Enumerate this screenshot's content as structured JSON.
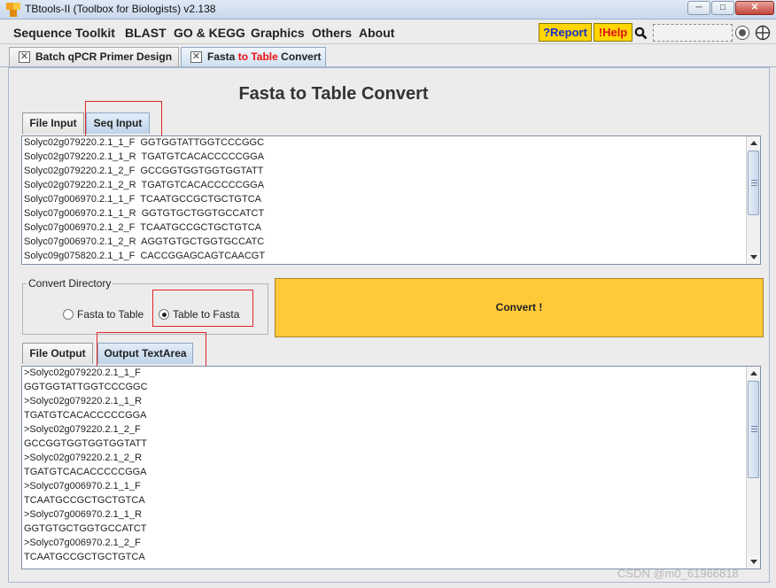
{
  "window": {
    "title": "TBtools-II (Toolbox for Biologists) v2.138",
    "minimize": "─",
    "maximize": "□",
    "close": "✕"
  },
  "menu": {
    "items": [
      "Sequence Toolkit",
      "BLAST",
      "GO & KEGG",
      "Graphics",
      "Others",
      "About"
    ],
    "report_label": "?Report",
    "help_label": "!Help"
  },
  "doc_tabs": {
    "tab1": "Batch qPCR Primer Design",
    "tab2_part1": "Fasta",
    "tab2_part2": " to Table",
    "tab2_part3": " Convert"
  },
  "page": {
    "title": "Fasta to Table Convert"
  },
  "input_tabs": [
    "File Input",
    "Seq Input"
  ],
  "seq_input_lines": [
    "Solyc02g079220.2.1_1_F  GGTGGTATTGGTCCCGGC",
    "Solyc02g079220.2.1_1_R  TGATGTCACACCCCCGGA",
    "Solyc02g079220.2.1_2_F  GCCGGTGGTGGTGGTATT",
    "Solyc02g079220.2.1_2_R  TGATGTCACACCCCCGGA",
    "Solyc07g006970.2.1_1_F  TCAATGCCGCTGCTGTCA",
    "Solyc07g006970.2.1_1_R  GGTGTGCTGGTGCCATCT",
    "Solyc07g006970.2.1_2_F  TCAATGCCGCTGCTGTCA",
    "Solyc07g006970.2.1_2_R  AGGTGTGCTGGTGCCATC",
    "Solyc09g075820.2.1_1_F  CACCGGAGCAGTCAACGT"
  ],
  "convert_directory": {
    "legend": "Convert Directory",
    "option1": "Fasta to Table",
    "option2": "Table to Fasta",
    "selected": "Table to Fasta"
  },
  "convert_button": "Convert !",
  "output_tabs": [
    "File Output",
    "Output TextArea"
  ],
  "output_lines": [
    ">Solyc02g079220.2.1_1_F",
    "GGTGGTATTGGTCCCGGC",
    ">Solyc02g079220.2.1_1_R",
    "TGATGTCACACCCCCGGA",
    ">Solyc02g079220.2.1_2_F",
    "GCCGGTGGTGGTGGTATT",
    ">Solyc02g079220.2.1_2_R",
    "TGATGTCACACCCCCGGA",
    ">Solyc07g006970.2.1_1_F",
    "TCAATGCCGCTGCTGTCA",
    ">Solyc07g006970.2.1_1_R",
    "GGTGTGCTGGTGCCATCT",
    ">Solyc07g006970.2.1_2_F",
    "TCAATGCCGCTGCTGTCA"
  ],
  "watermark": "CSDN @m0_61966818",
  "colors": {
    "accent_yellow": "#ffd600",
    "convert_button": "#ffc93a",
    "help_red": "#e01010",
    "report_blue": "#1a2fc8",
    "highlight_red": "#e12626"
  }
}
